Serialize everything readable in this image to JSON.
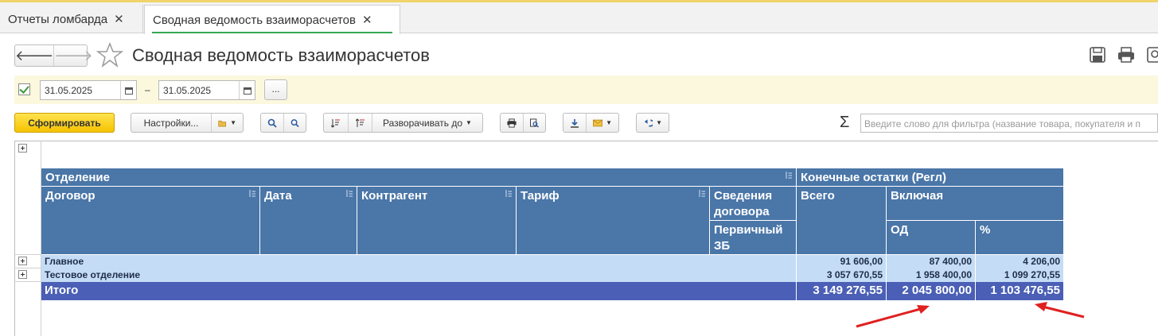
{
  "tabs": [
    {
      "label": "Отчеты ломбарда",
      "close": "✕"
    },
    {
      "label": "Сводная ведомость взаиморасчетов",
      "close": "✕"
    }
  ],
  "nav": {
    "back": "🡐",
    "forward": "🡒"
  },
  "title": "Сводная ведомость взаиморасчетов",
  "filter": {
    "checked": true,
    "date_from": "31.05.2025",
    "date_to": "31.05.2025",
    "separator": "–",
    "more_label": "..."
  },
  "toolbar": {
    "generate_label": "Сформировать",
    "settings_label": "Настройки...",
    "expand_label": "Разворачивать до",
    "sigma": "Σ",
    "search_placeholder": "Введите слово для фильтра (название товара, покупателя и п"
  },
  "icons": [
    "save-icon",
    "print-icon",
    "preview-icon",
    "star-icon",
    "calendar-icon",
    "search-icon",
    "sort-icon",
    "download-icon",
    "mail-icon",
    "back-arrow-icon"
  ],
  "table": {
    "header": {
      "department": "Отделение",
      "end_balances": "Конечные остатки (Регл)",
      "contract": "Договор",
      "date": "Дата",
      "counterparty": "Контрагент",
      "tariff": "Тариф",
      "contract_info": "Сведения договора",
      "primary_zb": "Первичный ЗБ",
      "total": "Всего",
      "including": "Включая",
      "od": "ОД",
      "percent": "%"
    },
    "rows": [
      {
        "name": "Главное",
        "total": "91 606,00",
        "od": "87 400,00",
        "percent": "4 206,00"
      },
      {
        "name": "Тестовое отделение",
        "total": "3 057 670,55",
        "od": "1 958 400,00",
        "percent": "1 099 270,55"
      }
    ],
    "summary": {
      "label": "Итого",
      "total": "3 149 276,55",
      "od": "2 045 800,00",
      "percent": "1 103 476,55"
    }
  },
  "colors": {
    "header": "#4a76a8",
    "group_row": "#c4dcf5",
    "total_row": "#4a5fb5",
    "annotation": "#e02020"
  }
}
